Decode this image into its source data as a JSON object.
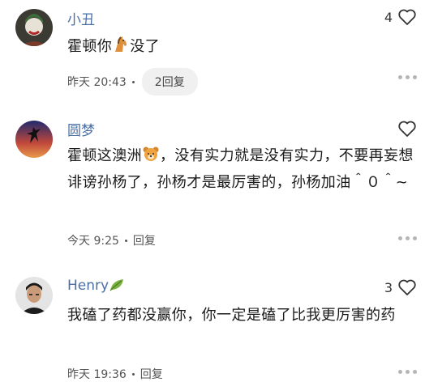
{
  "comments": [
    {
      "user": "小丑",
      "likes": "4",
      "text_before": "霍顿你",
      "emoji": "horse-emoji",
      "text_after": "没了",
      "time": "昨天 20:43",
      "reply_label": "2回复"
    },
    {
      "user": "圆梦",
      "likes": "",
      "text_before": "霍顿这澳洲",
      "emoji": "bear-emoji",
      "text_after": "，没有实力就是没有实力，不要再妄想诽谤孙杨了，孙杨才是最厉害的，孙杨加油＾０＾~",
      "time": "今天 9:25",
      "reply_label": "回复"
    },
    {
      "user": "Henry",
      "user_emoji": "leaf-emoji",
      "likes": "3",
      "text": "我磕了药都没赢你，你一定是磕了比我更厉害的药",
      "time": "昨天 19:36",
      "reply_label": "回复"
    }
  ],
  "colors": {
    "username": "#4a6fa5",
    "meta": "#555555",
    "pill_bg": "#f0f0f0"
  }
}
